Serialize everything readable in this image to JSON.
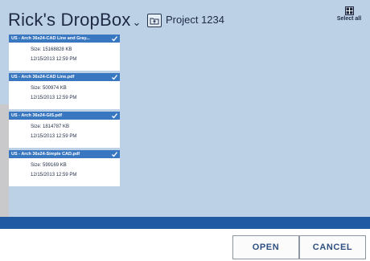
{
  "header": {
    "app_title": "Rick's DropBox",
    "folder_name": "Project 1234",
    "select_all_label": "Select all"
  },
  "files": [
    {
      "name": "US - Arch 36x24-CAD Line and Gray...",
      "size": "Size:  15168828  KB",
      "date": "12/15/2013 12:59 PM",
      "selected": true
    },
    {
      "name": "US - Arch 36x24-CAD Line.pdf",
      "size": "Size:  500974  KB",
      "date": "12/15/2013 12:59 PM",
      "selected": true
    },
    {
      "name": "US - Arch 36x24-GIS.pdf",
      "size": "Size:  1814787  KB",
      "date": "12/15/2013 12:59 PM",
      "selected": true
    },
    {
      "name": "US - Arch 36x24-Simple CAD.pdf",
      "size": "Size:  599169  KB",
      "date": "12/15/2013 12:59 PM",
      "selected": true
    }
  ],
  "footer": {
    "open_label": "OPEN",
    "cancel_label": "CANCEL"
  },
  "colors": {
    "background": "#bcd0e6",
    "name_bar": "#3977c0",
    "status_bar": "#1f5aa3",
    "button_text": "#2d4f80"
  }
}
